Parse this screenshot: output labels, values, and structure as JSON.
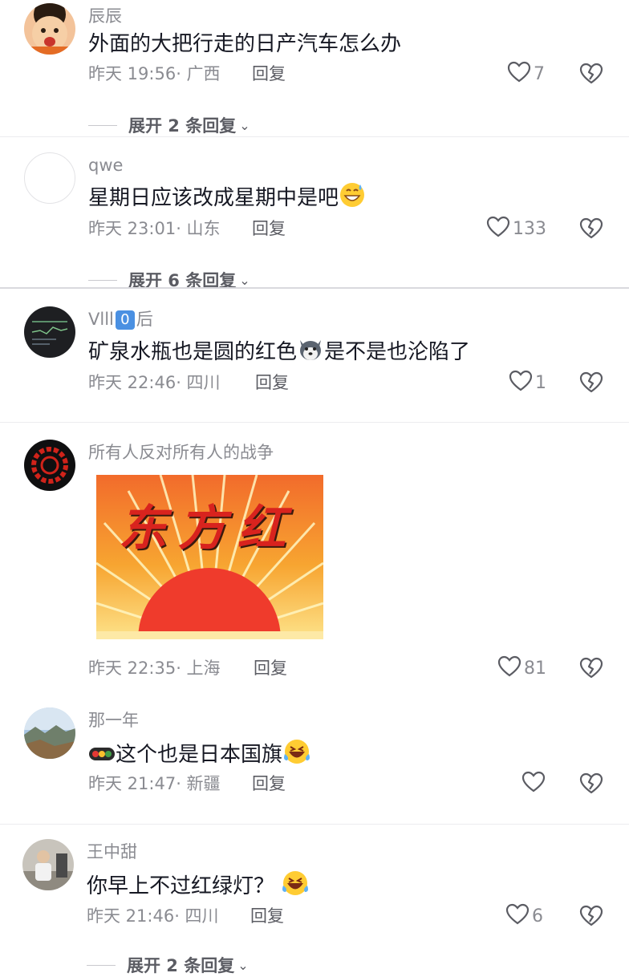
{
  "comments": [
    {
      "username": "辰辰",
      "text": "外面的大把行走的日产汽车怎么办",
      "time": "昨天 19:56",
      "location": "· 广西",
      "reply_label": "回复",
      "likes": "7",
      "expand_label": "展开 2 条回复"
    },
    {
      "username": "qwe",
      "text": "星期日应该改成星期中是吧",
      "time": "昨天 23:01",
      "location": "· 山东",
      "reply_label": "回复",
      "likes": "133",
      "expand_label": "展开 6 条回复"
    },
    {
      "username_prefix": "Vlll",
      "username_badge": "0",
      "username_suffix": "后",
      "text_before": "矿泉水瓶也是圆的红色",
      "text_after": "是不是也沦陷了",
      "time": "昨天 22:46",
      "location": "· 四川",
      "reply_label": "回复",
      "likes": "1"
    },
    {
      "username": "所有人反对所有人的战争",
      "image_text": "东方红",
      "time": "昨天 22:35",
      "location": "· 上海",
      "reply_label": "回复",
      "likes": "81"
    },
    {
      "username": "那一年",
      "text": "这个也是日本国旗",
      "time": "昨天 21:47",
      "location": "· 新疆",
      "reply_label": "回复",
      "likes": ""
    },
    {
      "username": "王中甜",
      "text": "你早上不过红绿灯？",
      "time": "昨天 21:46",
      "location": "· 四川",
      "reply_label": "回复",
      "likes": "6",
      "expand_label": "展开 2 条回复"
    }
  ],
  "icons": {
    "like": "heart-outline-icon",
    "dislike": "broken-heart-icon",
    "expand": "chevron-down-icon"
  },
  "colors": {
    "text_primary": "#161823",
    "text_secondary": "#8a8b91",
    "separator": "#d9d9de",
    "sun_red": "#ef3b2c",
    "sun_orange": "#f7941d"
  }
}
